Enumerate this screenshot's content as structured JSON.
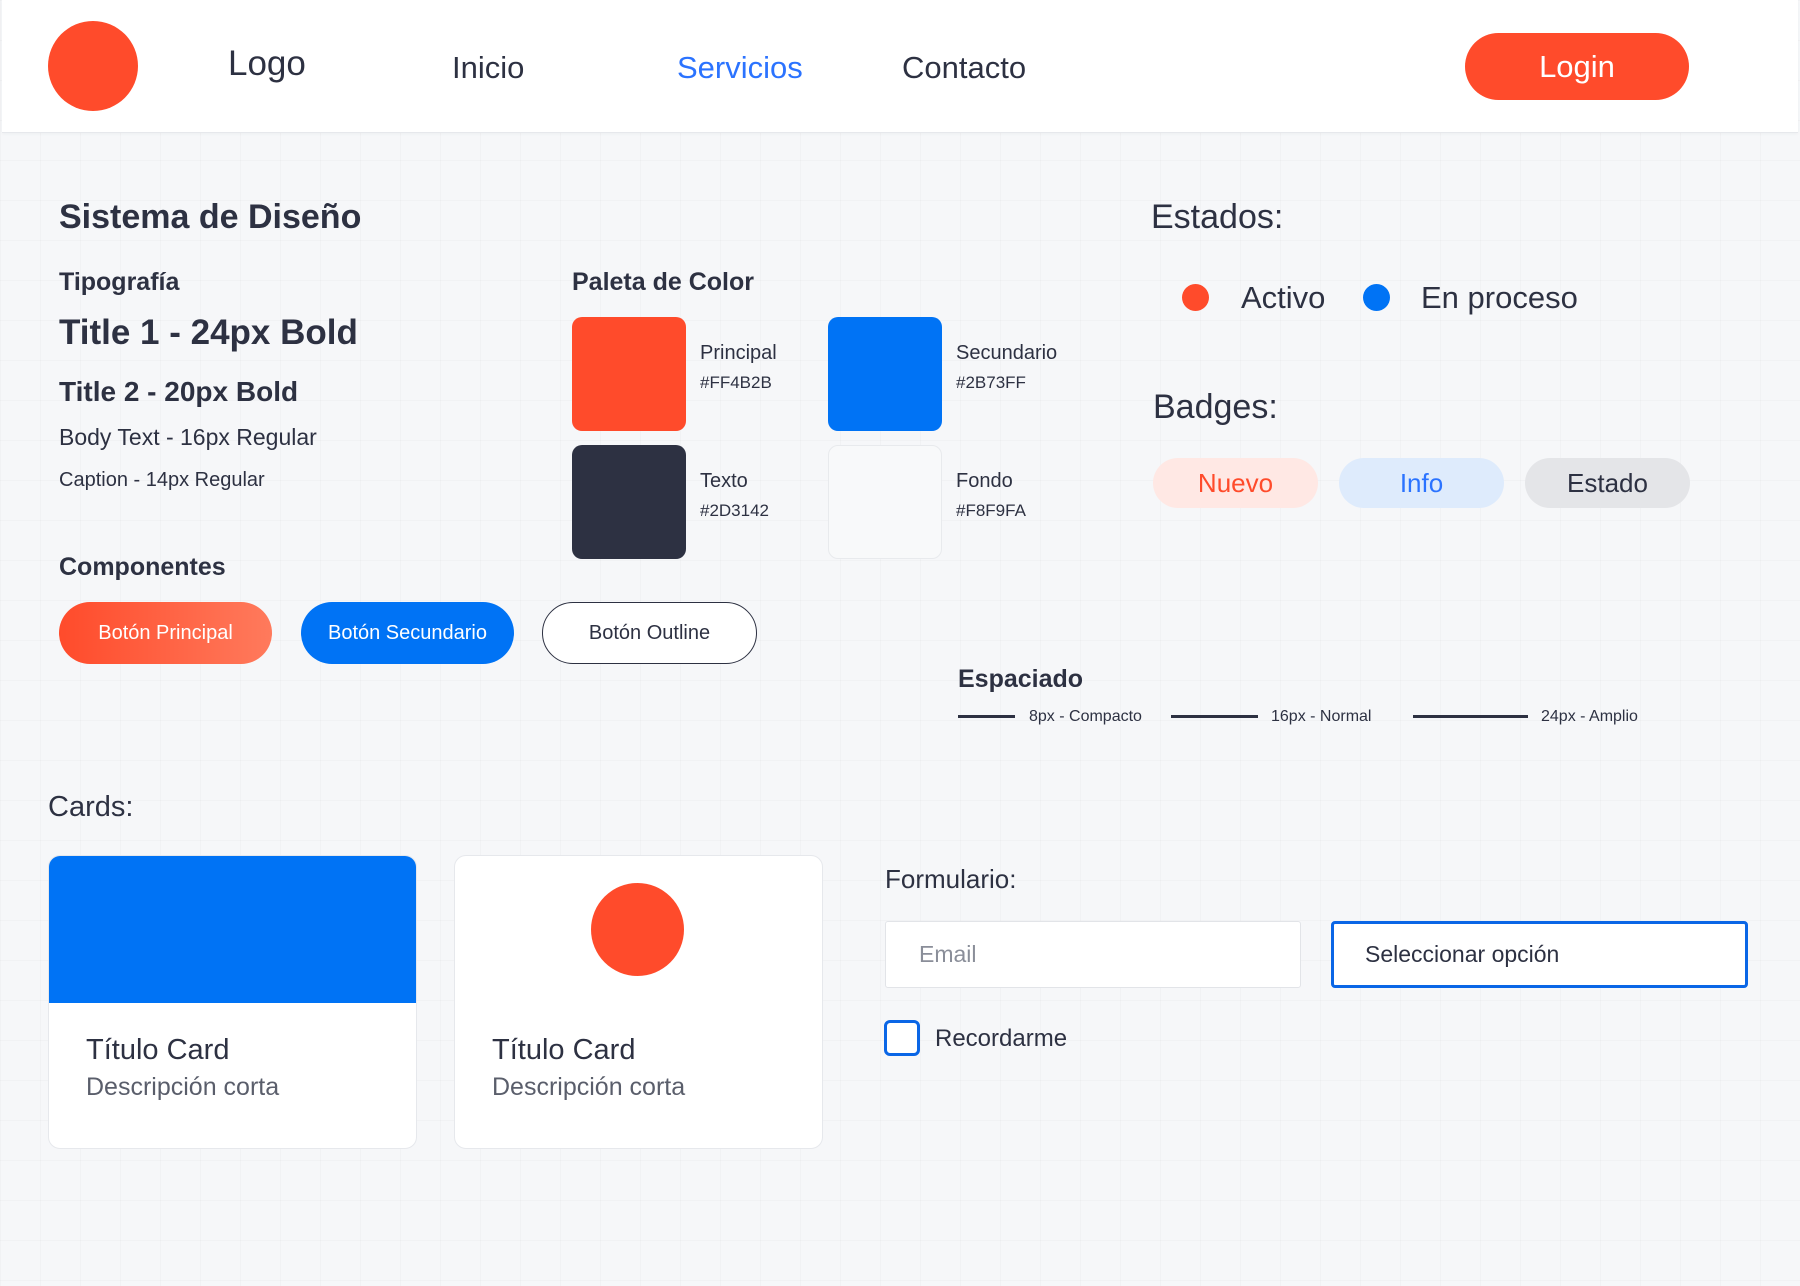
{
  "header": {
    "logo_text": "Logo",
    "nav": [
      "Inicio",
      "Servicios",
      "Contacto"
    ],
    "active_nav": "Servicios",
    "login_label": "Login"
  },
  "design_system": {
    "title": "Sistema de Diseño",
    "typography": {
      "heading": "Tipografía",
      "title1": "Title 1 - 24px Bold",
      "title2": "Title 2 - 20px Bold",
      "body": "Body Text - 16px Regular",
      "caption": "Caption - 14px Regular"
    },
    "components": {
      "heading": "Componentes",
      "primary_button": "Botón Principal",
      "secondary_button": "Botón Secundario",
      "outline_button": "Botón Outline"
    },
    "palette": {
      "heading": "Paleta de Color",
      "colors": [
        {
          "name": "Principal",
          "hex": "#FF4B2B"
        },
        {
          "name": "Secundario",
          "hex": "#2B73FF"
        },
        {
          "name": "Texto",
          "hex": "#2D3142"
        },
        {
          "name": "Fondo",
          "hex": "#F8F9FA"
        }
      ]
    }
  },
  "states": {
    "heading": "Estados:",
    "items": [
      {
        "label": "Activo",
        "color": "#FF4B2B"
      },
      {
        "label": "En proceso",
        "color": "#2B73FF"
      }
    ]
  },
  "badges": {
    "heading": "Badges:",
    "items": [
      "Nuevo",
      "Info",
      "Estado"
    ]
  },
  "spacing": {
    "heading": "Espaciado",
    "items": [
      "8px - Compacto",
      "16px - Normal",
      "24px - Amplio"
    ]
  },
  "cards": {
    "heading": "Cards:",
    "items": [
      {
        "title": "Título Card",
        "description": "Descripción corta"
      },
      {
        "title": "Título Card",
        "description": "Descripción corta"
      }
    ]
  },
  "form": {
    "heading": "Formulario:",
    "email_placeholder": "Email",
    "select_value": "Seleccionar opción",
    "checkbox_label": "Recordarme"
  },
  "colors": {
    "primary": "#FF4B2B",
    "secondary": "#2B73FF",
    "text": "#2D3142",
    "background": "#F8F9FA"
  }
}
